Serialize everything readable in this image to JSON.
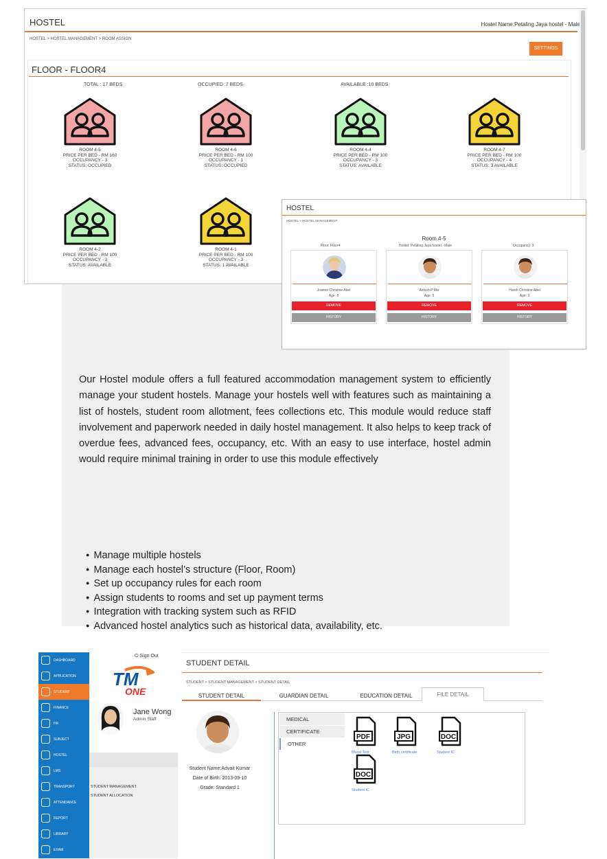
{
  "floor_window": {
    "title": "HOSTEL",
    "hostel_name": "Hostel Name:Petaling Jaya hostel - Male",
    "breadcrumb": [
      "HOSTEL",
      "HOSTEL MANAGEMENT",
      "ROOM ASSIGN"
    ],
    "settings_label": "SETTINGS",
    "floor_title": "FLOOR - FLOOR4",
    "stats": {
      "total": "TOTAL : 17 BEDS",
      "occupied": "OCCUPIED :7 BEDS",
      "available": "AVAILABLE :10 BEDS"
    },
    "rooms": [
      {
        "name": "ROOM 4-5",
        "price": "PRICE PER BED - RM 160",
        "occupancy": "OCCUPANCY - 3",
        "status": "STATUS: OCCUPIED",
        "color": "#f4a6a6"
      },
      {
        "name": "ROOM 4-6",
        "price": "PRICE PER BED - RM 100",
        "occupancy": "OCCUPANCY - 1",
        "status": "STATUS: OCCUPIED",
        "color": "#f4a6a6"
      },
      {
        "name": "ROOM 4-4",
        "price": "PRICE PER BED - RM 100",
        "occupancy": "OCCUPANCY - 3",
        "status": "STATUS: AVAILABLE",
        "color": "#b9f4b9"
      },
      {
        "name": "ROOM 4-7",
        "price": "PRICE PER BED - RM 100",
        "occupancy": "OCCUPANCY - 4",
        "status": "STATUS: 3 AVAILABLE",
        "color": "#f3d53a"
      },
      {
        "name": "ROOM 4-2",
        "price": "PRICE PER BED - RM 100",
        "occupancy": "OCCUPANCY - 3",
        "status": "STATUS: AVAILABLE",
        "color": "#b9f4b9"
      },
      {
        "name": "ROOM 4-1",
        "price": "PRICE PER BED - RM 100",
        "occupancy": "OCCUPANCY - 3",
        "status": "STATUS: 1 AVAILABLE",
        "color": "#f3d53a"
      }
    ]
  },
  "room_window": {
    "title": "HOSTEL",
    "breadcrumb": [
      "HOSTEL",
      "HOSTEL MANAGEMENT"
    ],
    "room_title": "Room 4-5",
    "floor": "Floor: Floor4",
    "hostel": "Hostel: Petaling Jaya hostel - Male",
    "occupancy": "Occupancy: 3",
    "students": [
      {
        "name": "Joanne Christine Abel",
        "age": "Age: 8",
        "remove": "REMOVE",
        "history": "HISTORY"
      },
      {
        "name": "Ashish P Mis",
        "age": "Age: 5",
        "remove": "REMOVE",
        "history": "HISTORY"
      },
      {
        "name": "Harsh Christine Abel",
        "age": "Age: 3",
        "remove": "REMOVE",
        "history": "HISTORY"
      }
    ]
  },
  "description": "Our Hostel module offers a full featured accommodation management system to efficiently manage your student hostels. Manage your hostels well with features such as maintaining a list of hostels, student room allotment, fees collections etc. This module would reduce staff involvement and paperwork needed in daily hostel management. It also helps to keep track of overdue fees, advanced fees, occupancy, etc. With an easy to use interface, hostel admin would require minimal training in order to use this module effectively",
  "features": [
    "Manage multiple hostels",
    "Manage each hostel’s structure (Floor, Room)",
    "Set up occupancy rules for each room",
    "Assign students to rooms and set up payment terms",
    "Integration with tracking system such as RFID",
    "Advanced hostel analytics such as historical data, availability, etc."
  ],
  "student_app": {
    "sidebar": [
      "DASHBOARD",
      "APPLICATION",
      "STUDENT",
      "FINANCE",
      "HR",
      "SUBJECT",
      "HOSTEL",
      "LMS",
      "TRANSPORT",
      "ATTENDANCE",
      "REPORT",
      "LIBRARY",
      "EXAM"
    ],
    "active_item": "STUDENT",
    "sign_out": "Sign Out",
    "logo": {
      "line1": "TM",
      "line2": "ONE"
    },
    "user_name": "Jane Wong",
    "user_role": "Admin Staff",
    "side_menu": [
      "STUDENT MANAGEMENT",
      "STUDENT ALLOCATION"
    ],
    "page_title": "STUDENT DETAIL",
    "breadcrumb": [
      "STUDENT",
      "STUDENT MANAGEMENT",
      "STUDENT DETAIL"
    ],
    "tabs": [
      "STUDENT DETAIL",
      "GUARDIAN DETAIL",
      "EDUCATION DETAIL",
      "FILE DETAIL"
    ],
    "active_tab": "FILE DETAIL",
    "student_name": "Student Name:Advait Kumar",
    "dob": "Date of Birth: 2013-09-10",
    "grade": "Grade: Standard 1",
    "file_categories": [
      "MEDICAL",
      "CERTIFICATE",
      "OTHER"
    ],
    "files": [
      {
        "type": "PDF",
        "label": "Blood Test"
      },
      {
        "type": "JPG",
        "label": "Birth certificate"
      },
      {
        "type": "DOC",
        "label": "Student IC"
      },
      {
        "type": "DOC",
        "label": "Student IC"
      }
    ]
  }
}
